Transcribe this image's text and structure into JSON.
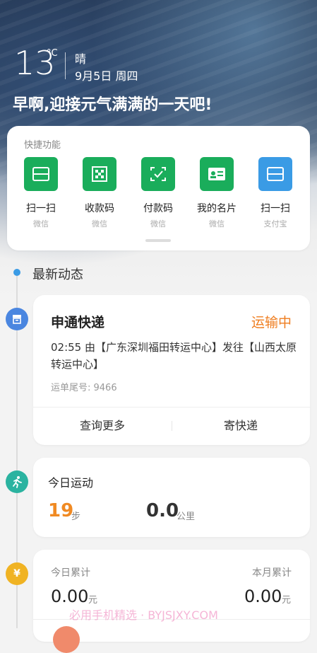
{
  "weather": {
    "temperature": "13",
    "unit": "°C",
    "condition": "晴",
    "date": "9月5日  周四"
  },
  "greeting": "早啊,迎接元气满满的一天吧!",
  "quick_actions": {
    "title": "快捷功能",
    "items": [
      {
        "label": "扫一扫",
        "sub": "微信",
        "icon": "scan-icon",
        "color": "#1aad5b"
      },
      {
        "label": "收款码",
        "sub": "微信",
        "icon": "qr-code-icon",
        "color": "#1aad5b"
      },
      {
        "label": "付款码",
        "sub": "微信",
        "icon": "payment-code-icon",
        "color": "#1aad5b"
      },
      {
        "label": "我的名片",
        "sub": "微信",
        "icon": "business-card-icon",
        "color": "#1aad5b"
      },
      {
        "label": "扫一扫",
        "sub": "支付宝",
        "icon": "scan-icon",
        "color": "#3a9be5"
      }
    ]
  },
  "feed": {
    "title": "最新动态",
    "express": {
      "carrier": "申通快递",
      "status": "运输中",
      "detail": "02:55  由【广东深圳福田转运中心】发往【山西太原转运中心】",
      "tracking": "运单尾号: 9466",
      "more_label": "查询更多",
      "send_label": "寄快递",
      "icon_color": "#4a86e0"
    },
    "sport": {
      "title": "今日运动",
      "steps": "19",
      "steps_unit": "步",
      "distance": "0.0",
      "distance_unit": "公里",
      "icon_color": "#2bb3a0"
    },
    "money": {
      "today_label": "今日累计",
      "today_value": "0.00",
      "month_label": "本月累计",
      "month_value": "0.00",
      "unit": "元",
      "icon_color": "#f0b323"
    }
  },
  "watermark": "必用手机精选 · BYJSJXY.COM"
}
